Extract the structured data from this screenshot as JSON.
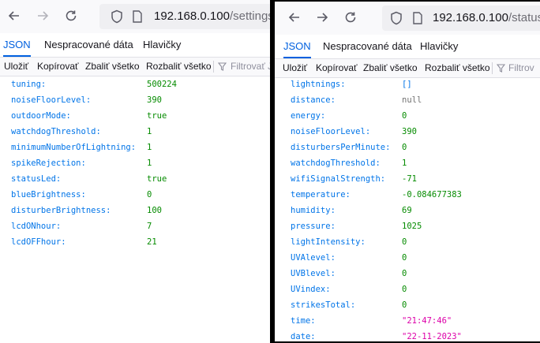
{
  "left_window": {
    "url_host": "192.168.0.100",
    "url_path": "/settings",
    "tabs": [
      "JSON",
      "Nespracované dáta",
      "Hlavičky"
    ],
    "actions": [
      "Uložiť",
      "Kopírovať",
      "Zbaliť všetko",
      "Rozbaliť všetko"
    ],
    "filter_placeholder": "Filtrovať JS",
    "rows": [
      {
        "key": "tuning:",
        "value": "500224",
        "type": "number"
      },
      {
        "key": "noiseFloorLevel:",
        "value": "390",
        "type": "number"
      },
      {
        "key": "outdoorMode:",
        "value": "true",
        "type": "bool"
      },
      {
        "key": "watchdogThreshold:",
        "value": "1",
        "type": "number"
      },
      {
        "key": "minimumNumberOfLightning:",
        "value": "1",
        "type": "number"
      },
      {
        "key": "spikeRejection:",
        "value": "1",
        "type": "number"
      },
      {
        "key": "statusLed:",
        "value": "true",
        "type": "bool"
      },
      {
        "key": "blueBrightness:",
        "value": "0",
        "type": "number"
      },
      {
        "key": "disturberBrightness:",
        "value": "100",
        "type": "number"
      },
      {
        "key": "lcdONhour:",
        "value": "7",
        "type": "number"
      },
      {
        "key": "lcdOFFhour:",
        "value": "21",
        "type": "number"
      }
    ]
  },
  "right_window": {
    "url_host": "192.168.0.100",
    "url_path": "/status",
    "tabs": [
      "JSON",
      "Nespracované dáta",
      "Hlavičky"
    ],
    "actions": [
      "Uložiť",
      "Kopírovať",
      "Zbaliť všetko",
      "Rozbaliť všetko"
    ],
    "filter_placeholder": "Filtrov",
    "rows": [
      {
        "key": "lightnings:",
        "value": "[]",
        "type": "array"
      },
      {
        "key": "distance:",
        "value": "null",
        "type": "null"
      },
      {
        "key": "energy:",
        "value": "0",
        "type": "number"
      },
      {
        "key": "noiseFloorLevel:",
        "value": "390",
        "type": "number"
      },
      {
        "key": "disturbersPerMinute:",
        "value": "0",
        "type": "number"
      },
      {
        "key": "watchdogThreshold:",
        "value": "1",
        "type": "number"
      },
      {
        "key": "wifiSignalStrength:",
        "value": "-71",
        "type": "number"
      },
      {
        "key": "temperature:",
        "value": "-0.084677383",
        "type": "number"
      },
      {
        "key": "humidity:",
        "value": "69",
        "type": "number"
      },
      {
        "key": "pressure:",
        "value": "1025",
        "type": "number"
      },
      {
        "key": "lightIntensity:",
        "value": "0",
        "type": "number"
      },
      {
        "key": "UVAlevel:",
        "value": "0",
        "type": "number"
      },
      {
        "key": "UVBlevel:",
        "value": "0",
        "type": "number"
      },
      {
        "key": "UVindex:",
        "value": "0",
        "type": "number"
      },
      {
        "key": "strikesTotal:",
        "value": "0",
        "type": "number"
      },
      {
        "key": "time:",
        "value": "\"21:47:46\"",
        "type": "string"
      },
      {
        "key": "date:",
        "value": "\"22-11-2023\"",
        "type": "string"
      }
    ]
  },
  "icons": [
    "back-arrow-icon",
    "forward-arrow-icon",
    "reload-icon",
    "shield-icon",
    "page-icon",
    "filter-icon"
  ],
  "colors": {
    "tab_active": "#0060df",
    "key": "#0074e8",
    "number": "#058b00",
    "string": "#dd00a9",
    "null": "#737373"
  }
}
